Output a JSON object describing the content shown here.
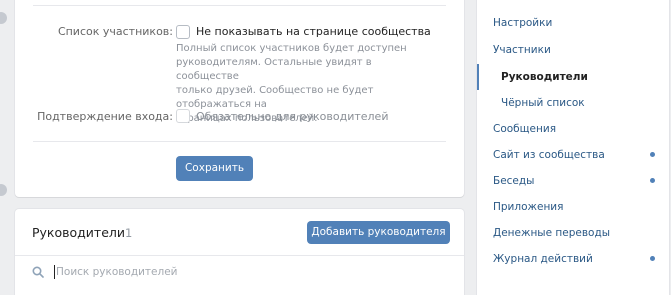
{
  "settings": {
    "members_list_label": "Список участников:",
    "members_list_checkbox": "Не показывать на странице сообщества",
    "members_list_hint": [
      "Полный список участников будет доступен",
      "руководителям. Остальные увидят в сообществе",
      "только друзей. Сообщество не будет отображаться на",
      "страницах пользователей."
    ],
    "login_confirm_label": "Подтверждение входа:",
    "login_confirm_checkbox": "Обязательно для руководителей",
    "save_label": "Сохранить"
  },
  "managers": {
    "title": "Руководители",
    "count": "1",
    "add_button": "Добавить руководителя",
    "search_placeholder": "Поиск руководителей"
  },
  "menu": {
    "items": [
      {
        "label": "Настройки"
      },
      {
        "label": "Участники"
      },
      {
        "label": "Руководители"
      },
      {
        "label": "Чёрный список"
      },
      {
        "label": "Сообщения"
      },
      {
        "label": "Сайт из сообщества"
      },
      {
        "label": "Беседы"
      },
      {
        "label": "Приложения"
      },
      {
        "label": "Денежные переводы"
      },
      {
        "label": "Журнал действий"
      }
    ]
  },
  "colors": {
    "accent": "#5181b8",
    "link": "#2a5885",
    "background": "#edeef0"
  }
}
